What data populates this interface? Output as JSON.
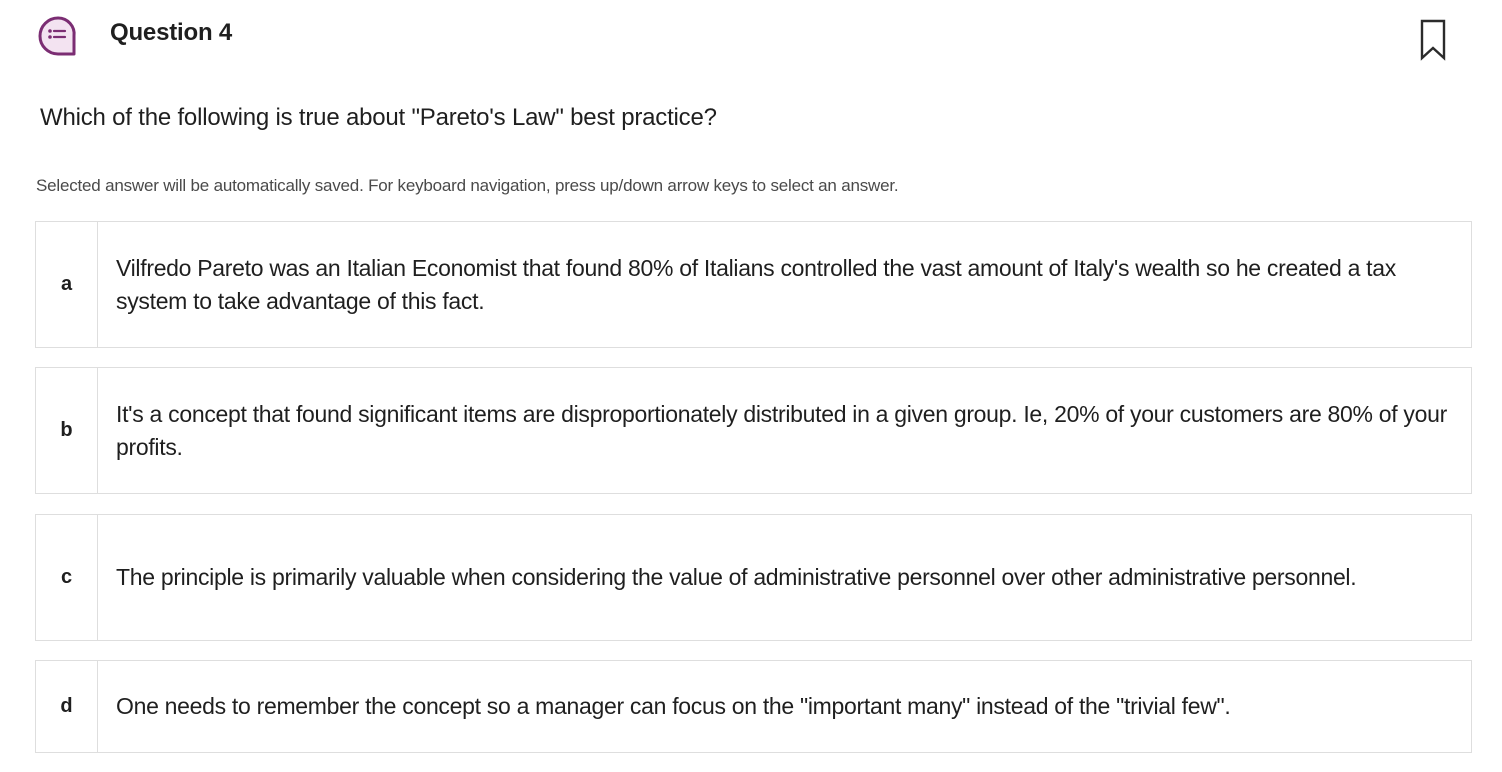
{
  "header": {
    "icon": "chat-list-icon",
    "title": "Question 4",
    "bookmark_icon": "bookmark-icon",
    "accent_color": "#7b2d73"
  },
  "question": {
    "text": "Which of the following is true about \"Pareto's Law\" best practice?",
    "instructions": "Selected answer will be automatically saved. For keyboard navigation, press up/down arrow keys to select an answer."
  },
  "options": [
    {
      "letter": "a",
      "text": "Vilfredo Pareto was an Italian Economist that found 80% of Italians controlled the vast amount of Italy's wealth so he created a tax system to take advantage of this fact."
    },
    {
      "letter": "b",
      "text": "It's a concept that found significant items are disproportionately distributed in a given group. Ie, 20% of your customers are 80% of your profits."
    },
    {
      "letter": "c",
      "text": "The principle is primarily valuable when considering the value of administrative personnel over other administrative personnel."
    },
    {
      "letter": "d",
      "text": "One needs to remember the concept so a manager can focus on the \"important many\" instead of the \"trivial few\"."
    }
  ]
}
